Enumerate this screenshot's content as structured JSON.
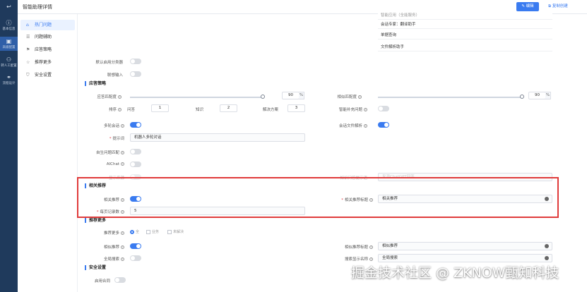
{
  "app": {
    "title": "智能助理详情"
  },
  "rail": [
    {
      "icon": "back-icon",
      "glyph": "↩",
      "label": ""
    },
    {
      "icon": "info-icon",
      "glyph": "ⓘ",
      "label": "基本信息"
    },
    {
      "icon": "assistant-icon",
      "glyph": "▣",
      "label": "高级配置"
    },
    {
      "icon": "person-icon",
      "glyph": "⚇",
      "label": "转人工配置"
    },
    {
      "icon": "flow-icon",
      "glyph": "⚭",
      "label": "流程设计"
    }
  ],
  "header": {
    "edit_label": "编辑",
    "copy_label": "复制创建"
  },
  "sidenav": [
    {
      "label": "热门问题",
      "glyph": "⌂",
      "icon": "home-icon"
    },
    {
      "label": "问题辅助",
      "glyph": "☰",
      "icon": "list-icon"
    },
    {
      "label": "应答策略",
      "glyph": "⚑",
      "icon": "strategy-icon"
    },
    {
      "label": "推荐更多",
      "glyph": "☆",
      "icon": "recommend-icon"
    },
    {
      "label": "安全设置",
      "glyph": "⛉",
      "icon": "shield-icon"
    }
  ],
  "dropdown": [
    "智能应用（全能服务）",
    "会话专家：翻译助手",
    "单据查询",
    "文件解析助手"
  ],
  "top_fields": {
    "default_app_label": "默认启用分类器",
    "followup_label": "联想输入"
  },
  "answer": {
    "section": "应答策略",
    "answer_match_label": "应答匹配度",
    "answer_match_value": "90",
    "similar_match_label": "相似匹配度",
    "similar_match_value": "90",
    "pct": "%",
    "sort_label": "排序",
    "sort_items": [
      {
        "label": "问答",
        "value": "1"
      },
      {
        "label": "知识",
        "value": "2"
      },
      {
        "label": "解决方案",
        "value": "3"
      }
    ],
    "smart_complete_label": "智能补充问题",
    "multi_turn_label": "多轮会话",
    "file_parse_label": "会话文件解析",
    "prompt_label": "提示词",
    "prompt_value": "机器人多轮对话",
    "auto_match_label": "自生问题匹配",
    "aichat_label": "AIChat",
    "hidden_label": "显示来源",
    "hidden_right_label": "知识问答提示语",
    "hidden_right_value": "来源ChatGPT回答"
  },
  "related": {
    "section": "相关推荐",
    "toggle_label": "相关推荐",
    "title_label": "相关推荐标题",
    "title_value": "相关推荐",
    "count_label": "每页记录数",
    "count_value": "5"
  },
  "more": {
    "section": "推荐更多",
    "more_label": "推荐更多",
    "options": [
      "全",
      "业务",
      "未解决"
    ],
    "similar_label": "相似推荐",
    "similar_title_label": "相似推荐标题",
    "similar_title_value": "相似推荐",
    "global_label": "全局搜索",
    "search_name_label": "搜索显示名称",
    "search_name_value": "全局搜索"
  },
  "security": {
    "section": "安全设置",
    "enable_label": "启用合同"
  },
  "watermark": "掘金技术社区 @ ZKNOW甄知科技"
}
